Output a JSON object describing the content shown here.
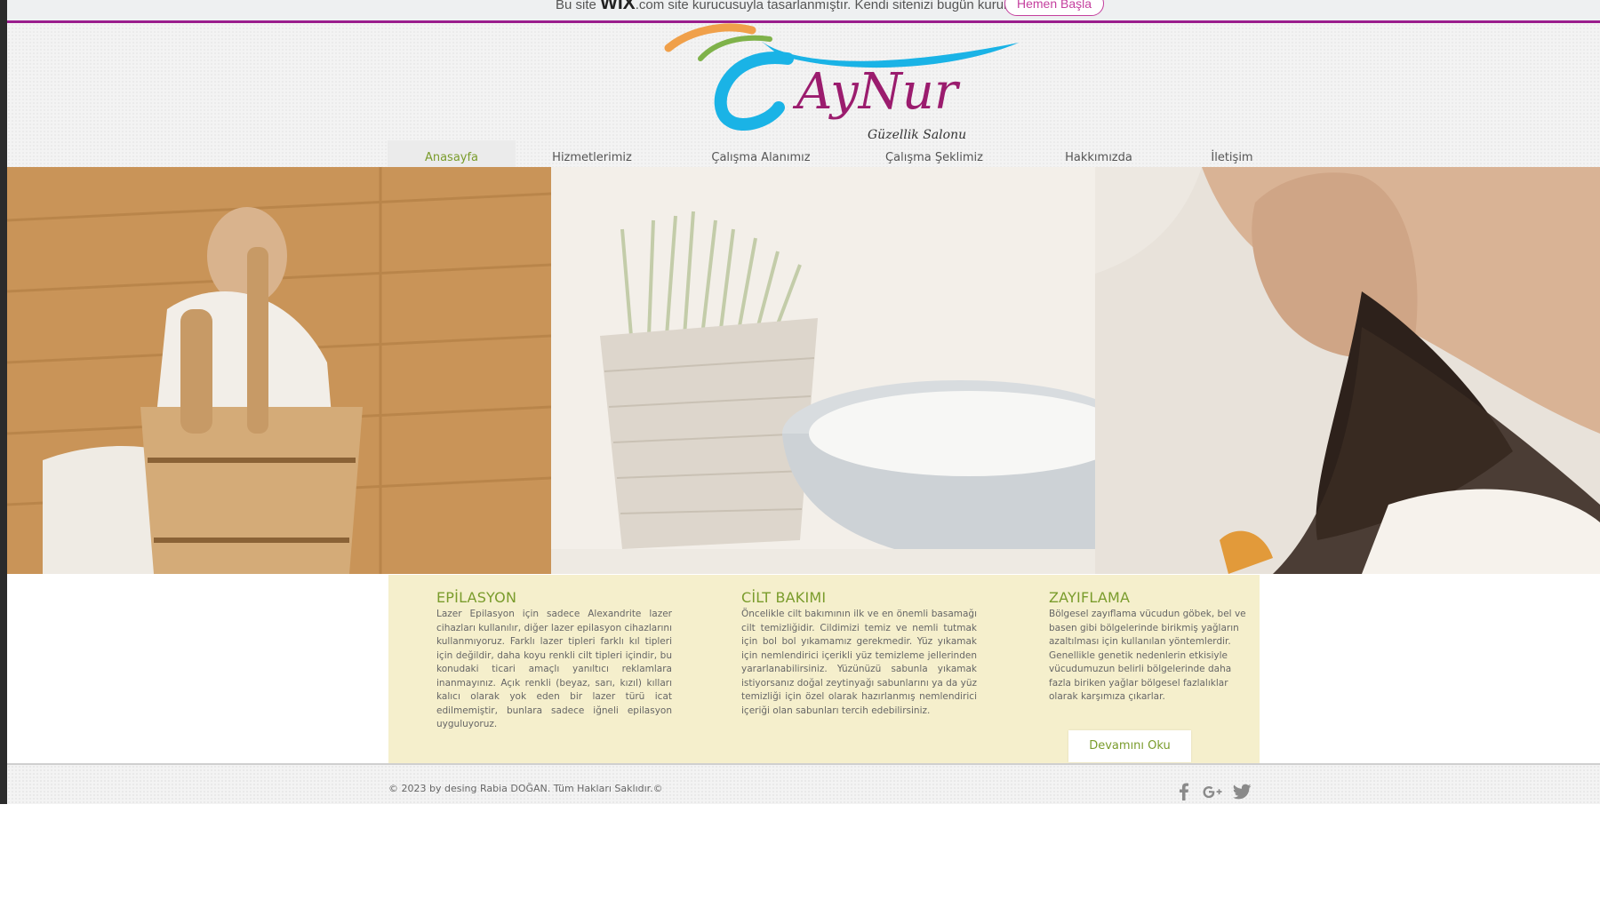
{
  "banner": {
    "text_prefix": "Bu site",
    "brand": "WIX",
    "text_suffix": ".com site kurucusuyla tasarlanmıştır. Kendi sitenizi bugün kurun.",
    "cta": "Hemen Başla"
  },
  "logo": {
    "name": "AyNur",
    "tagline": "Güzellik Salonu"
  },
  "nav": {
    "items": [
      "Anasayfa",
      "Hizmetlerimiz",
      "Çalışma Alanımız",
      "Çalışma Şeklimiz",
      "Hakkımızda",
      "İletişim"
    ],
    "active": "Anasayfa"
  },
  "services": [
    {
      "title": "EPİLASYON",
      "text": "Lazer Epilasyon için sadece Alexandrite lazer cihazları kullanılır, diğer lazer epilasyon cihazlarını kullanmıyoruz. Farklı lazer tipleri farklı kıl tipleri için değildir, daha koyu renkli cilt tipleri içindir, bu konudaki ticari amaçlı yanıltıcı reklamlara inanmayınız. Açık renkli (beyaz, sarı, kızıl) kılları kalıcı olarak yok eden bir lazer türü icat edilmemiştir, bunlara sadece iğneli epilasyon uyguluyoruz."
    },
    {
      "title": "CİLT  BAKIMI",
      "text": "Öncelikle cilt bakımının ilk ve en önemli basamağı cilt temizliğidir. Cildimizi temiz ve nemli tutmak için bol bol yıkamamız gerekmedir. Yüz yıkamak için nemlendirici içerikli yüz temizleme jellerinden yararlanabilirsiniz. Yüzünüzü sabunla yıkamak istiyorsanız doğal zeytinyağı sabunlarını ya da yüz temizliği için özel olarak hazırlanmış nemlendirici içeriği olan sabunları tercih edebilirsiniz."
    },
    {
      "title": "ZAYIFLAMA",
      "text": "Bölgesel zayıflama vücudun göbek, bel ve basen gibi bölgelerinde birikmiş yağların azaltılması için kullanılan yöntemlerdir. Genellikle genetik nedenlerin etkisiyle vücudumuzun belirli bölgelerinde daha fazla biriken yağlar bölgesel fazlalıklar olarak karşımıza çıkarlar."
    }
  ],
  "readmore": "Devamını Oku",
  "footer": {
    "copyright": "© 2023 by desing Rabia DOĞAN. Tüm Hakları Saklıdır.©",
    "social": [
      "facebook-icon",
      "google-plus-icon",
      "twitter-icon"
    ]
  },
  "colors": {
    "accent_green": "#7a9c2c",
    "banner_border": "#9a1d8c",
    "content_bg": "#f5efcc",
    "logo_magenta": "#9b1c6e",
    "logo_cyan": "#1ab3e6",
    "logo_orange": "#f0a04a"
  }
}
